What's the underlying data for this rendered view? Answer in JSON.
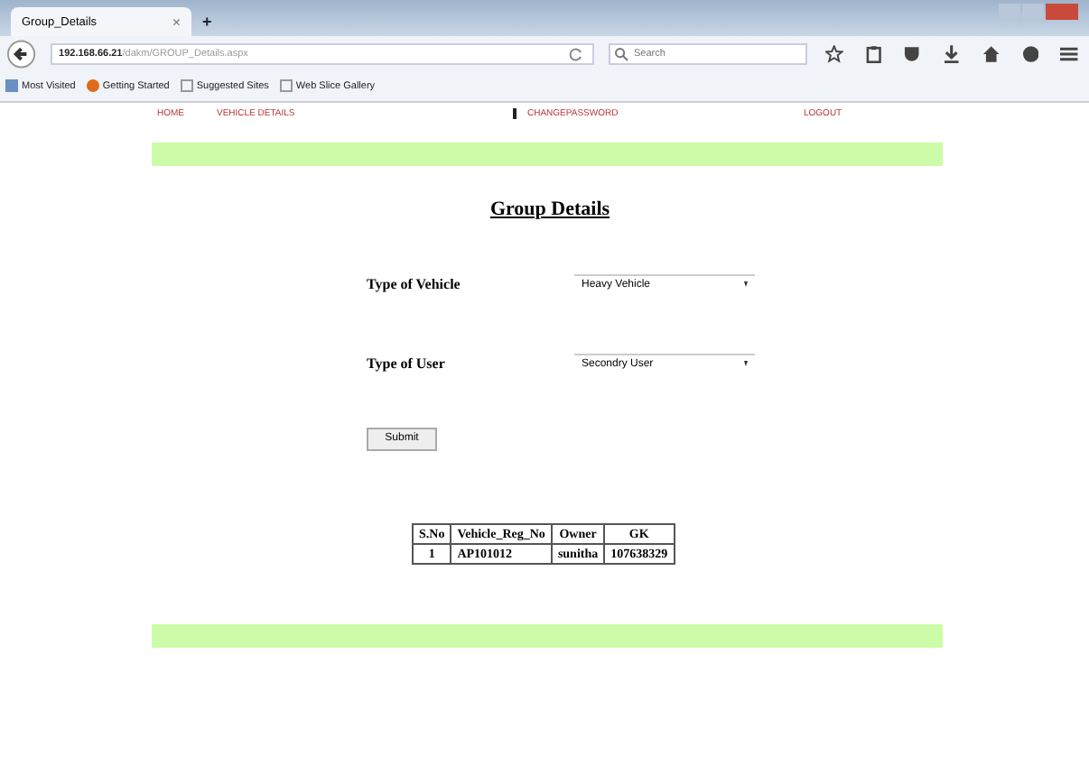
{
  "browser": {
    "tab_title": "Group_Details",
    "tab_close": "×",
    "new_tab": "+",
    "url_host": "192.168.66.21",
    "url_path": "/dakm/GROUP_Details.aspx",
    "search_placeholder": "Search",
    "bookmarks": [
      {
        "label": "Most Visited",
        "kind": "folder"
      },
      {
        "label": "Getting Started",
        "kind": "firefox"
      },
      {
        "label": "Suggested Sites",
        "kind": "page"
      },
      {
        "label": "Web Slice Gallery",
        "kind": "page"
      }
    ]
  },
  "nav": [
    {
      "label": "HOME",
      "selected": false
    },
    {
      "label": "VEHICLE DETAILS",
      "selected": false
    },
    {
      "label": "CHANGEPASSWORD",
      "selected": true
    },
    {
      "label": "LOGOUT",
      "selected": false
    }
  ],
  "title": "Group Details",
  "fields": [
    {
      "label": "Type of Vehicle",
      "value": "Heavy Vehicle"
    },
    {
      "label": "Type of User",
      "value": "Secondry User"
    }
  ],
  "submit": "Submit",
  "table": {
    "columns": [
      "S.No",
      "Vehicle_Reg_No",
      "Owner",
      "GK"
    ],
    "rows": [
      [
        "1",
        "AP101012",
        "sunitha",
        "107638329"
      ]
    ]
  }
}
